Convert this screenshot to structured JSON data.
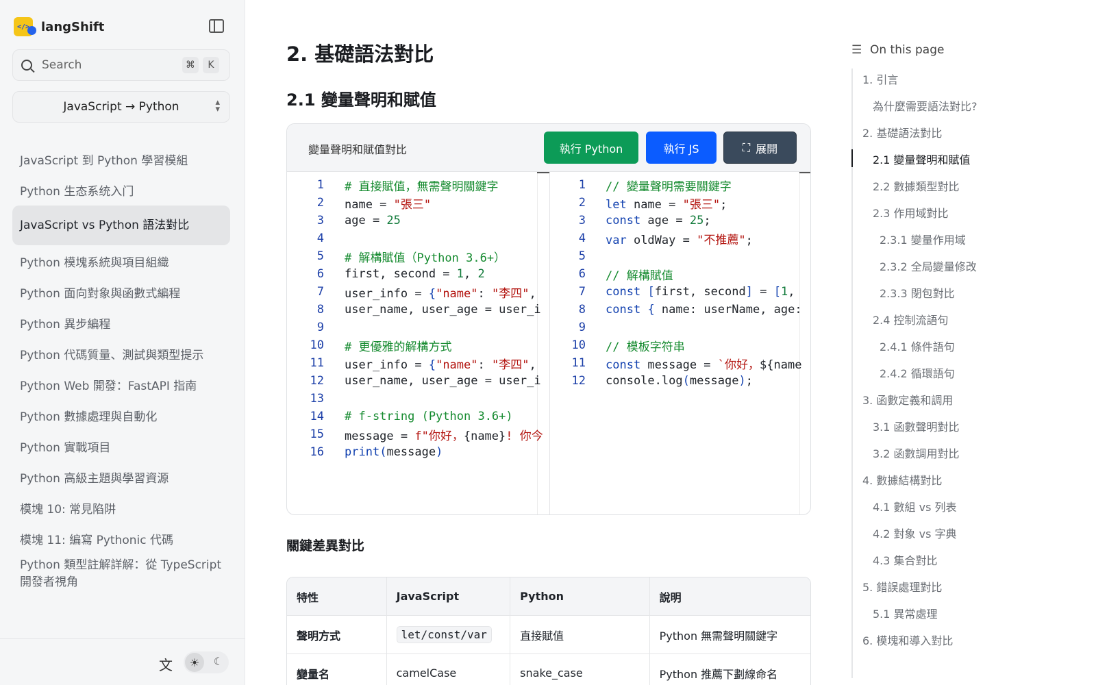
{
  "app": {
    "name": "langShift"
  },
  "search": {
    "label": "Search",
    "key1": "⌘",
    "key2": "K"
  },
  "lang_select": {
    "value": "JavaScript → Python"
  },
  "sidebar": {
    "items": [
      "JavaScript 到 Python 學習模組",
      "Python 生态系统入门",
      "JavaScript vs Python 語法對比",
      "Python 模塊系統與項目組織",
      "Python 面向對象與函數式編程",
      "Python 異步編程",
      "Python 代碼質量、測試與類型提示",
      "Python Web 開發：FastAPI 指南",
      "Python 數據處理與自動化",
      "Python 實戰項目",
      "Python 高級主題與學習資源",
      "模塊 10: 常見陷阱",
      "模塊 11: 編寫 Pythonic 代碼",
      "Python 類型註解詳解：從 TypeScript 開發者視角"
    ],
    "active_index": 2
  },
  "main": {
    "h1": "2. 基礎語法對比",
    "h2": "2.1 變量聲明和賦值"
  },
  "code_card": {
    "title": "變量聲明和賦值對比",
    "run_python": "執行 Python",
    "run_js": "執行 JS",
    "expand": "展開"
  },
  "python_code": [
    [
      {
        "t": "# 直接賦值，無需聲明關鍵字",
        "c": "com"
      }
    ],
    [
      {
        "t": "name = "
      },
      {
        "t": "\"張三\"",
        "c": "str"
      }
    ],
    [
      {
        "t": "age = "
      },
      {
        "t": "25",
        "c": "num"
      }
    ],
    [],
    [
      {
        "t": "# 解構賦值（Python 3.6+）",
        "c": "com"
      }
    ],
    [
      {
        "t": "first, second = "
      },
      {
        "t": "1",
        "c": "num"
      },
      {
        "t": ", "
      },
      {
        "t": "2",
        "c": "num"
      }
    ],
    [
      {
        "t": "user_info = "
      },
      {
        "t": "{",
        "c": "kw"
      },
      {
        "t": "\"name\"",
        "c": "str"
      },
      {
        "t": ": "
      },
      {
        "t": "\"李四\"",
        "c": "str"
      },
      {
        "t": ","
      }
    ],
    [
      {
        "t": "user_name, user_age = user_i"
      }
    ],
    [],
    [
      {
        "t": "# 更優雅的解構方式",
        "c": "com"
      }
    ],
    [
      {
        "t": "user_info = "
      },
      {
        "t": "{",
        "c": "kw"
      },
      {
        "t": "\"name\"",
        "c": "str"
      },
      {
        "t": ": "
      },
      {
        "t": "\"李四\"",
        "c": "str"
      },
      {
        "t": ","
      }
    ],
    [
      {
        "t": "user_name, user_age = user_i"
      }
    ],
    [],
    [
      {
        "t": "# f-string (Python 3.6+)",
        "c": "com"
      }
    ],
    [
      {
        "t": "message = "
      },
      {
        "t": "f\"你好，",
        "c": "str"
      },
      {
        "t": "{name}"
      },
      {
        "t": "! 你今",
        "c": "str"
      }
    ],
    [
      {
        "t": "print",
        "c": "fn"
      },
      {
        "t": "(",
        "c": "kw"
      },
      {
        "t": "message"
      },
      {
        "t": ")",
        "c": "kw"
      }
    ]
  ],
  "js_code": [
    [
      {
        "t": "// 變量聲明需要關鍵字",
        "c": "com"
      }
    ],
    [
      {
        "t": "let",
        "c": "kw"
      },
      {
        "t": " name = "
      },
      {
        "t": "\"張三\"",
        "c": "str"
      },
      {
        "t": ";"
      }
    ],
    [
      {
        "t": "const",
        "c": "kw"
      },
      {
        "t": " age = "
      },
      {
        "t": "25",
        "c": "num"
      },
      {
        "t": ";"
      }
    ],
    [
      {
        "t": "var",
        "c": "kw"
      },
      {
        "t": " oldWay = "
      },
      {
        "t": "\"不推薦\"",
        "c": "str"
      },
      {
        "t": ";"
      }
    ],
    [],
    [
      {
        "t": "// 解構賦值",
        "c": "com"
      }
    ],
    [
      {
        "t": "const",
        "c": "kw"
      },
      {
        "t": " "
      },
      {
        "t": "[",
        "c": "kw"
      },
      {
        "t": "first, second"
      },
      {
        "t": "]",
        "c": "kw"
      },
      {
        "t": " = "
      },
      {
        "t": "[",
        "c": "kw"
      },
      {
        "t": "1",
        "c": "num"
      },
      {
        "t": ","
      }
    ],
    [
      {
        "t": "const",
        "c": "kw"
      },
      {
        "t": " "
      },
      {
        "t": "{",
        "c": "kw"
      },
      {
        "t": " name: userName, age:"
      }
    ],
    [],
    [
      {
        "t": "// 模板字符串",
        "c": "com"
      }
    ],
    [
      {
        "t": "const",
        "c": "kw"
      },
      {
        "t": " message = "
      },
      {
        "t": "`你好，",
        "c": "str"
      },
      {
        "t": "${"
      },
      {
        "t": "name"
      }
    ],
    [
      {
        "t": "console.log"
      },
      {
        "t": "(",
        "c": "kw"
      },
      {
        "t": "message"
      },
      {
        "t": ")",
        "c": "kw"
      },
      {
        "t": ";"
      }
    ]
  ],
  "diff_section": {
    "title": "關鍵差異對比",
    "headers": [
      "特性",
      "JavaScript",
      "Python",
      "說明"
    ],
    "rows": [
      [
        "聲明方式",
        "let/const/var",
        "直接賦值",
        "Python 無需聲明關鍵字"
      ],
      [
        "變量名",
        "camelCase",
        "snake_case",
        "Python 推薦下劃線命名"
      ]
    ]
  },
  "toc": {
    "heading": "On this page",
    "active_index": 3,
    "items": [
      {
        "label": "1. 引言",
        "level": 1
      },
      {
        "label": "為什麼需要語法對比?",
        "level": 2
      },
      {
        "label": "2. 基礎語法對比",
        "level": 1
      },
      {
        "label": "2.1 變量聲明和賦值",
        "level": 2
      },
      {
        "label": "2.2 數據類型對比",
        "level": 2
      },
      {
        "label": "2.3 作用域對比",
        "level": 2
      },
      {
        "label": "2.3.1 變量作用域",
        "level": 3
      },
      {
        "label": "2.3.2 全局變量修改",
        "level": 3
      },
      {
        "label": "2.3.3 閉包對比",
        "level": 3
      },
      {
        "label": "2.4 控制流語句",
        "level": 2
      },
      {
        "label": "2.4.1 條件語句",
        "level": 3
      },
      {
        "label": "2.4.2 循環語句",
        "level": 3
      },
      {
        "label": "3. 函數定義和調用",
        "level": 1
      },
      {
        "label": "3.1 函數聲明對比",
        "level": 2
      },
      {
        "label": "3.2 函數調用對比",
        "level": 2
      },
      {
        "label": "4. 數據結構對比",
        "level": 1
      },
      {
        "label": "4.1 數組 vs 列表",
        "level": 2
      },
      {
        "label": "4.2 對象 vs 字典",
        "level": 2
      },
      {
        "label": "4.3 集合對比",
        "level": 2
      },
      {
        "label": "5. 錯誤處理對比",
        "level": 1
      },
      {
        "label": "5.1 異常處理",
        "level": 2
      },
      {
        "label": "6. 模塊和導入對比",
        "level": 1
      }
    ]
  },
  "icons": {
    "translate": "translate-icon",
    "sun": "sun-icon",
    "moon": "moon-icon",
    "expand": "expand-icon",
    "toc": "list-icon"
  }
}
